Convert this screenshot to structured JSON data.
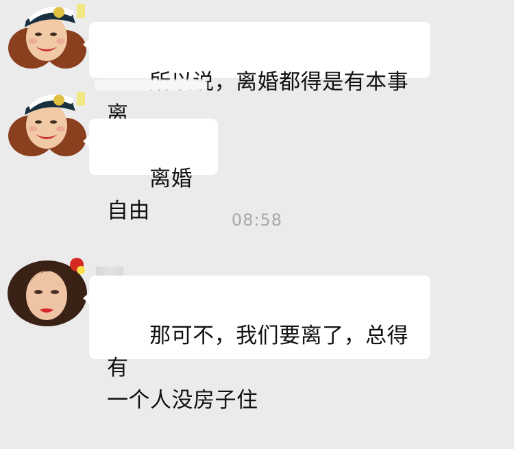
{
  "messages": [
    {
      "avatar": "sailor-pinup-avatar-icon",
      "text": "所以说，离婚都得是有本事离"
    },
    {
      "avatar": "sailor-pinup-avatar-icon",
      "text": "离婚自由"
    },
    {
      "avatar": "brunette-pinup-avatar-icon",
      "text": "那可不，我们要离了，总得有\n一个人没房子住"
    }
  ],
  "timestamp": "08:58",
  "colors": {
    "background": "#ebebeb",
    "bubble": "#ffffff",
    "timestamp": "#a8a8a8"
  }
}
